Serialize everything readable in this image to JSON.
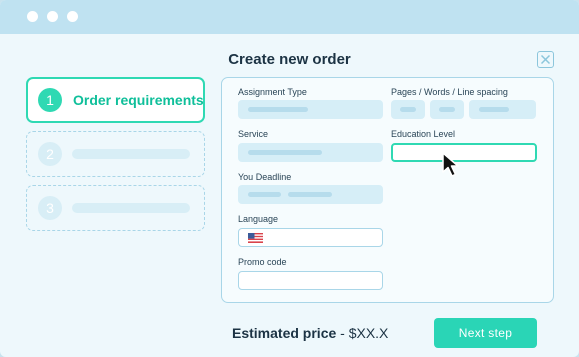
{
  "dialog": {
    "title": "Create new order"
  },
  "steps": [
    {
      "number": "1",
      "label": "Order requirements",
      "state": "active"
    },
    {
      "number": "2",
      "label": "",
      "state": "pending"
    },
    {
      "number": "3",
      "label": "",
      "state": "pending"
    }
  ],
  "form": {
    "assignment_type_label": "Assignment Type",
    "pages_words_label": "Pages / Words / Line spacing",
    "service_label": "Service",
    "education_level_label": "Education Level",
    "deadline_label": "You Deadline",
    "language_label": "Language",
    "promo_code_label": "Promo code"
  },
  "footer": {
    "price_prefix": "Estimated price",
    "price_value": " - $XX.X",
    "next_label": "Next step"
  },
  "icons": {
    "close": "close-icon",
    "flag": "us-flag-icon",
    "cursor": "mouse-pointer-icon"
  },
  "colors": {
    "accent": "#2fd9b3",
    "field_fill": "#d6eef7",
    "border": "#a9d6e8",
    "title_bar": "#bfe2f1"
  }
}
